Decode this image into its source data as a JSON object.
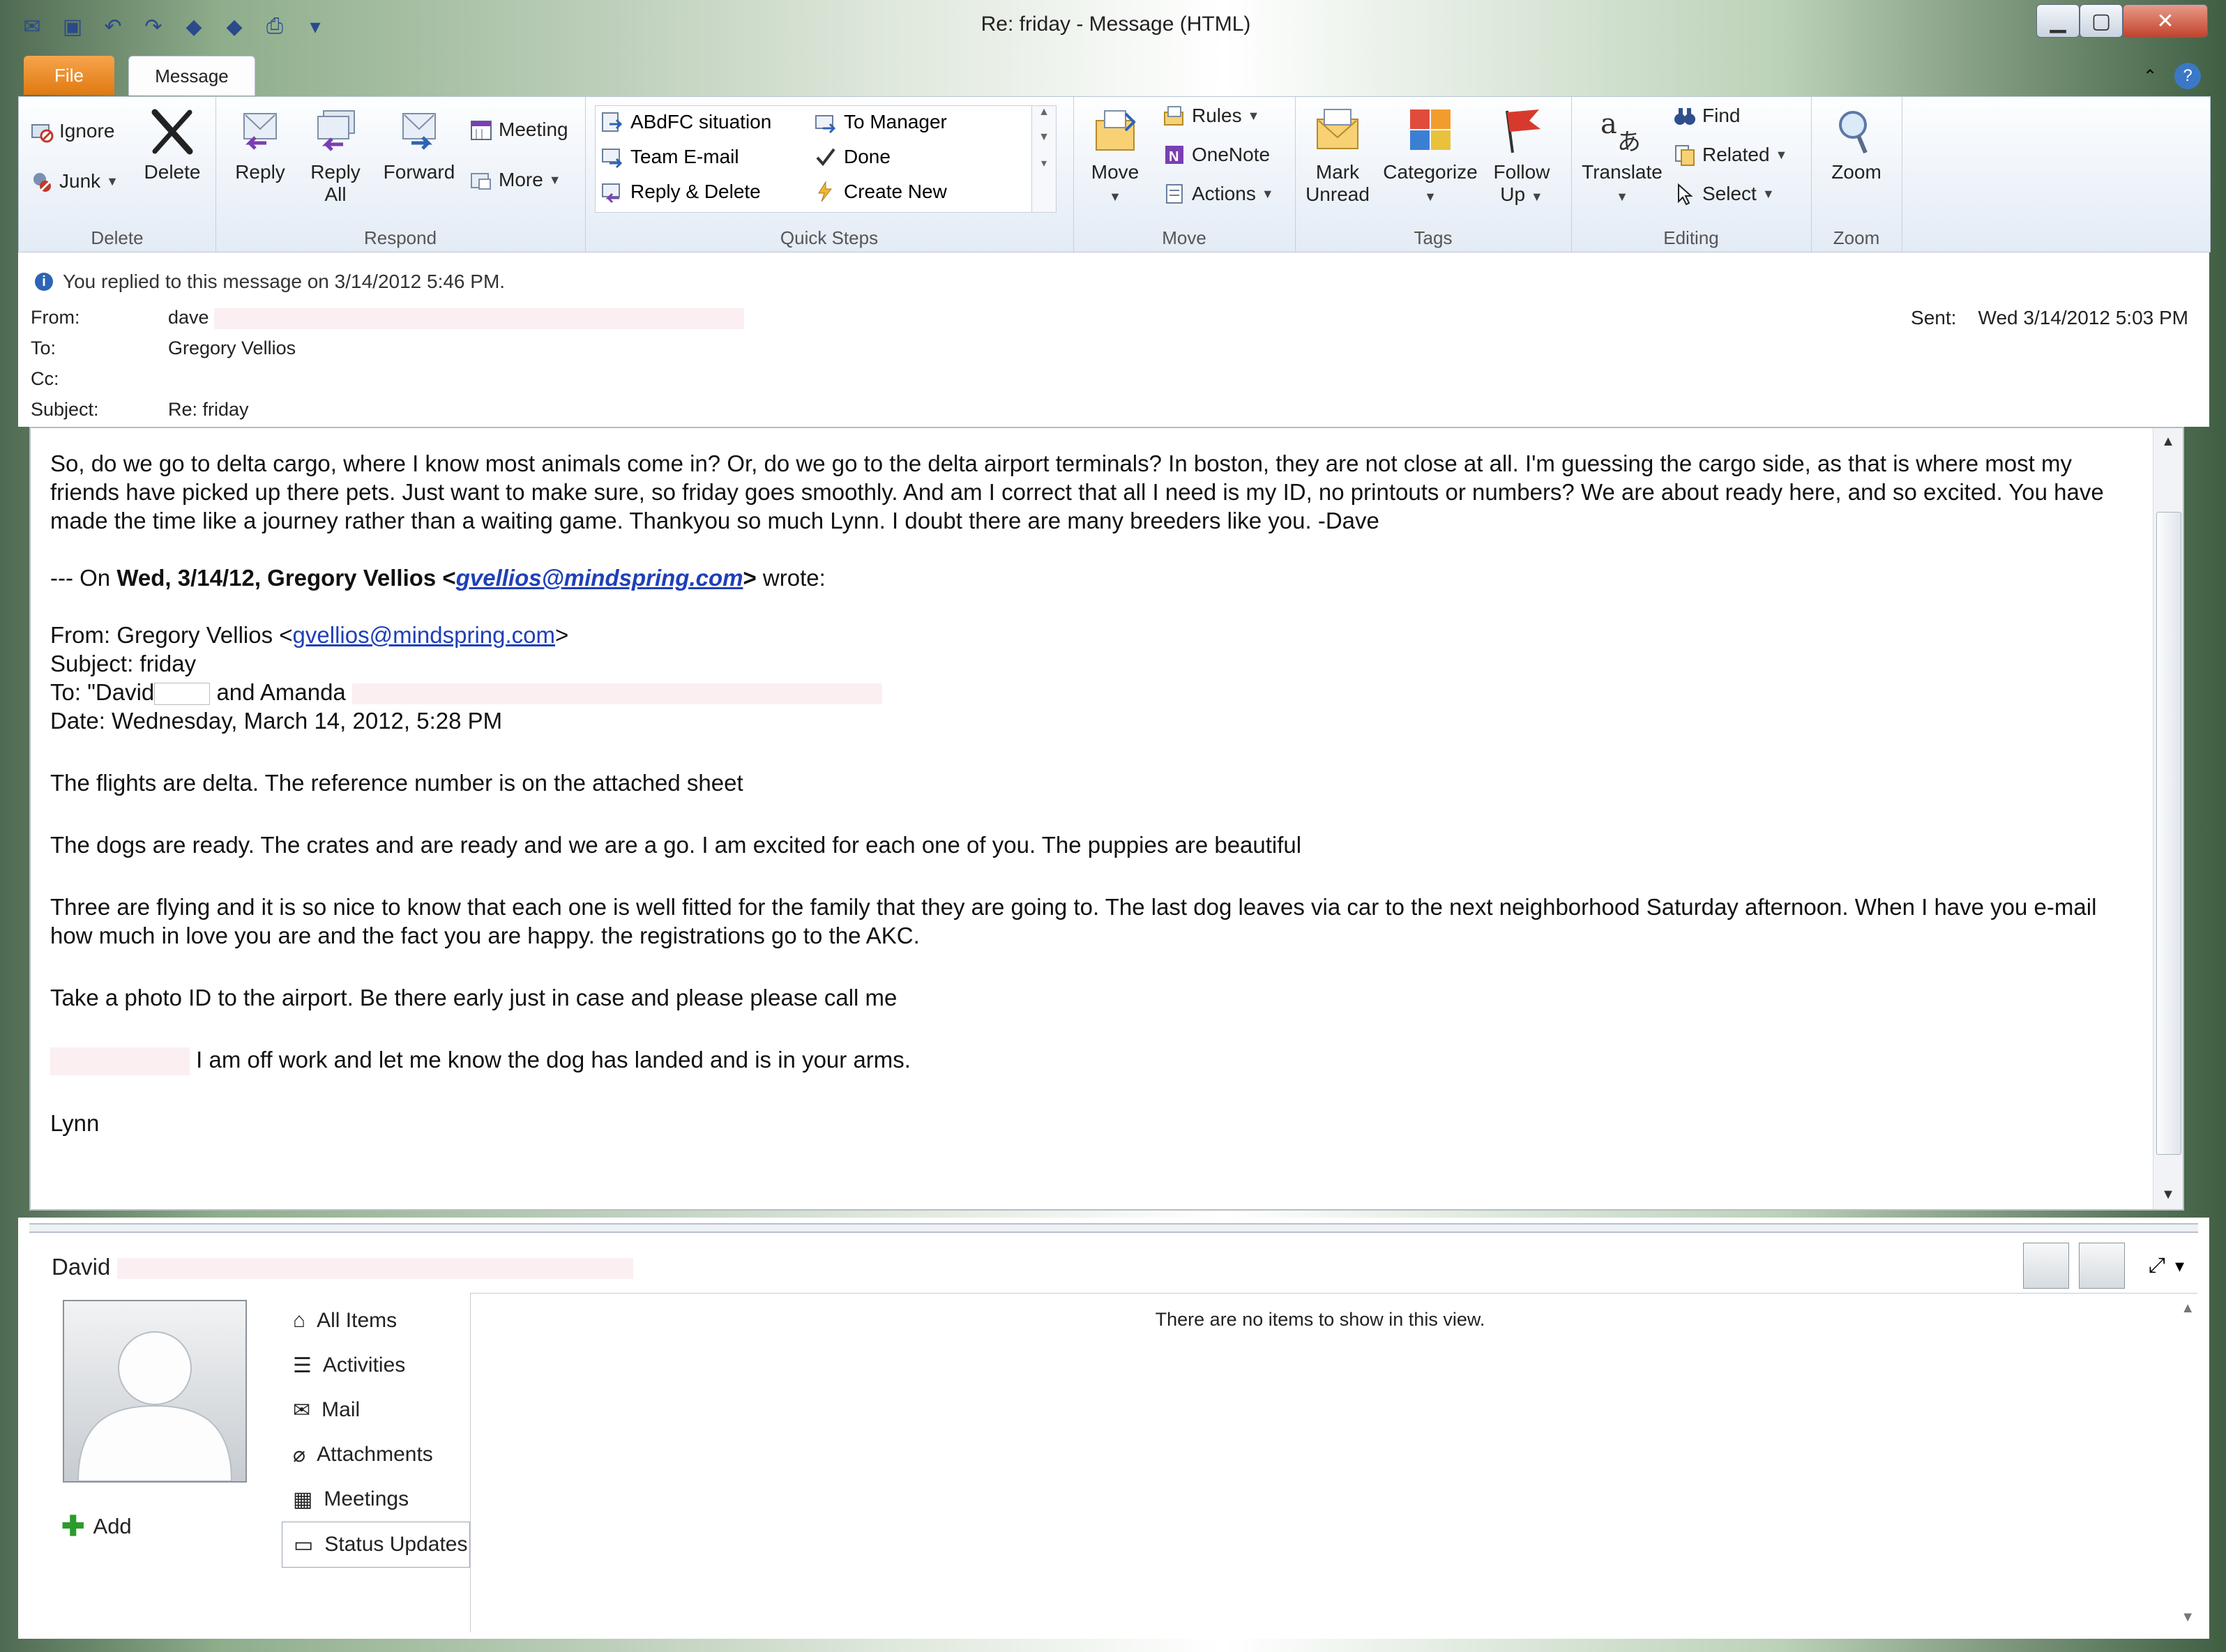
{
  "window": {
    "title": "Re: friday  -  Message (HTML)"
  },
  "tabs": {
    "file": "File",
    "message": "Message"
  },
  "ribbon": {
    "delete_group": {
      "ignore": "Ignore",
      "junk": "Junk",
      "delete": "Delete",
      "label": "Delete"
    },
    "respond_group": {
      "reply": "Reply",
      "reply_all_1": "Reply",
      "reply_all_2": "All",
      "forward": "Forward",
      "meeting": "Meeting",
      "more": "More",
      "label": "Respond"
    },
    "quick_steps": {
      "label": "Quick Steps",
      "items": [
        "ABdFC situation",
        "Team E-mail",
        "Reply & Delete",
        "To Manager",
        "Done",
        "Create New"
      ]
    },
    "move_group": {
      "move": "Move",
      "rules": "Rules",
      "onenote": "OneNote",
      "actions": "Actions",
      "label": "Move"
    },
    "tags_group": {
      "mark_unread_1": "Mark",
      "mark_unread_2": "Unread",
      "categorize": "Categorize",
      "follow_up_1": "Follow",
      "follow_up_2": "Up",
      "label": "Tags"
    },
    "editing_group": {
      "translate": "Translate",
      "find": "Find",
      "related": "Related",
      "select": "Select",
      "label": "Editing"
    },
    "zoom_group": {
      "zoom": "Zoom",
      "label": "Zoom"
    }
  },
  "header": {
    "info": "You replied to this message on 3/14/2012 5:46 PM.",
    "from_label": "From:",
    "from_value": "dave",
    "to_label": "To:",
    "to_value": "Gregory Vellios",
    "cc_label": "Cc:",
    "subject_label": "Subject:",
    "subject_value": "Re: friday",
    "sent_label": "Sent:",
    "sent_value": "Wed 3/14/2012 5:03 PM"
  },
  "body": {
    "p1": "So, do we go to delta cargo, where I know most animals come in? Or, do we go to the delta airport terminals? In boston, they are not close at all.  I'm guessing the cargo side, as that is where most my friends have picked up there pets.  Just want to make sure, so friday goes smoothly.  And am I correct that all I need is my ID, no printouts or numbers? We are about ready here, and so excited.  You have made the time like a journey rather than a waiting game.  Thankyou so much Lynn.  I doubt there are many breeders like you. -Dave",
    "quote_prefix": "--- On ",
    "quote_bold": "Wed, 3/14/12, Gregory Vellios <",
    "quote_email": "gvellios@mindspring.com",
    "quote_bold_end": ">",
    "quote_suffix": " wrote:",
    "fw_from": "From: Gregory Vellios <",
    "fw_from_email": "gvellios@mindspring.com",
    "fw_from_end": ">",
    "fw_subject": "Subject: friday",
    "fw_to_a": "To: \"David",
    "fw_to_b": " and Amanda ",
    "fw_date": "Date: Wednesday, March 14, 2012, 5:28 PM",
    "p2": "The flights are delta. The reference number is on the attached sheet",
    "p3": "The dogs are ready. The crates and are ready and we are a go. I am excited for each one of you. The puppies are beautiful",
    "p4": "Three are flying and it is so nice to know that each one is well fitted for the family that they are going to. The last dog leaves via car to the next neighborhood Saturday afternoon. When I have you e-mail how much in love you are and the fact you are happy. the registrations go to the AKC.",
    "p5": "Take a photo ID to the airport. Be there early just in case and please please call me",
    "p6": " I am off work and let me know the dog has landed and is in your arms.",
    "signature": "Lynn"
  },
  "people_pane": {
    "name": "David",
    "add": "Add",
    "nav": [
      "All Items",
      "Activities",
      "Mail",
      "Attachments",
      "Meetings",
      "Status Updates"
    ],
    "empty": "There are no items to show in this view."
  }
}
